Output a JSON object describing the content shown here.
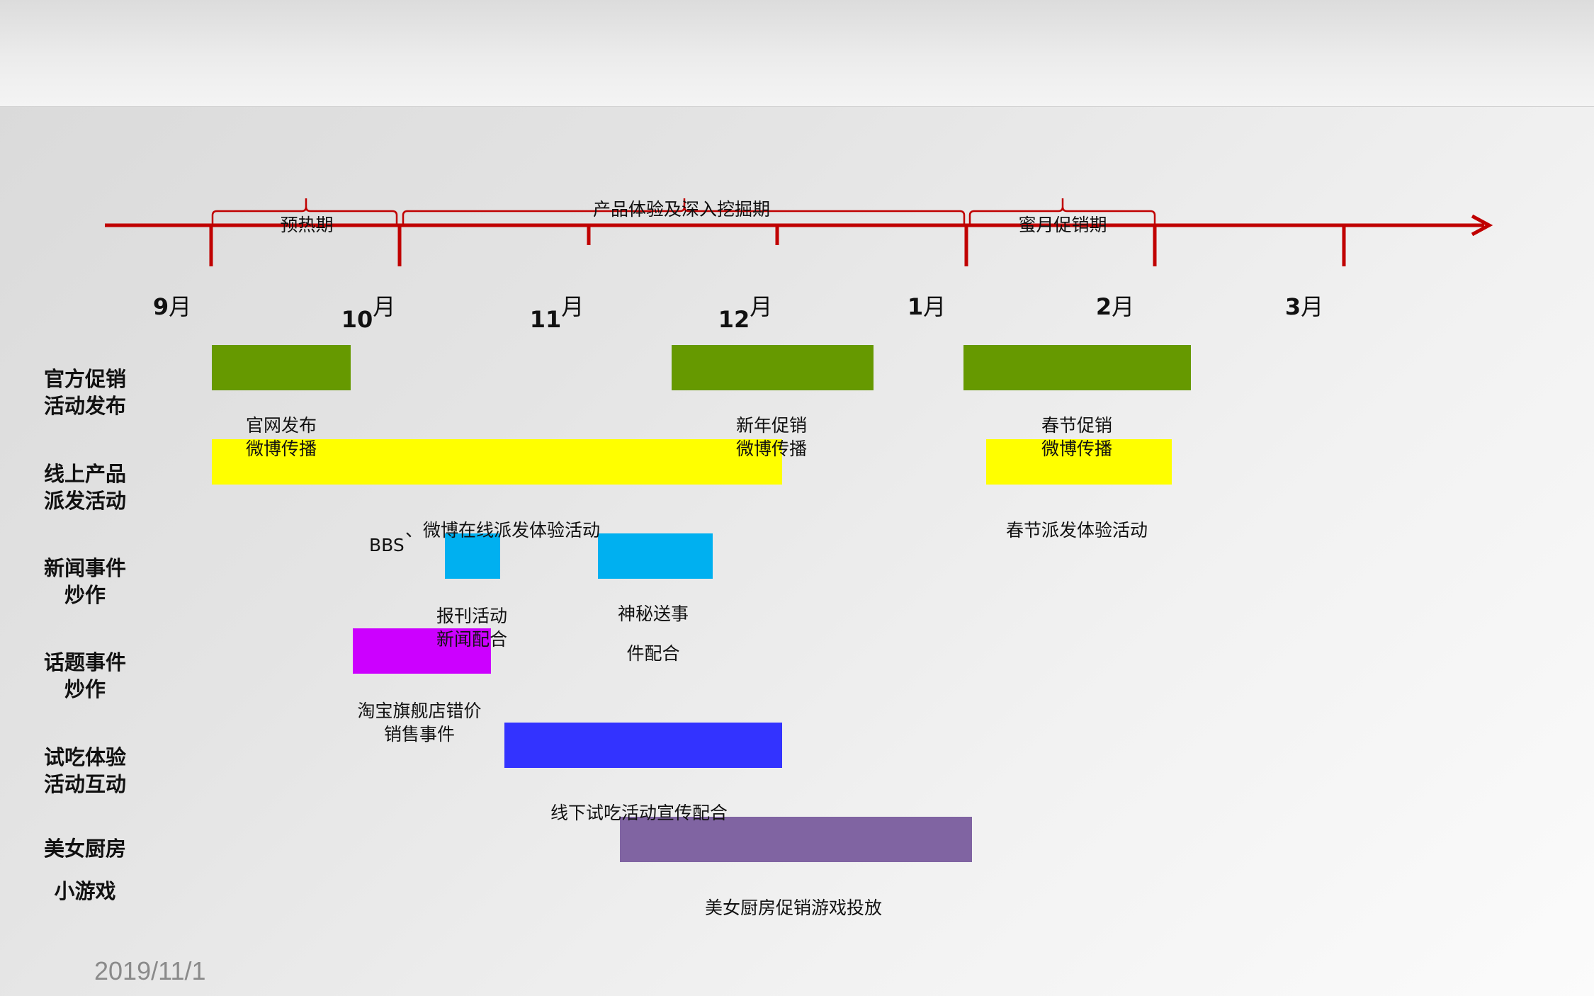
{
  "months": [
    "9月",
    "10月",
    "11月",
    "12月",
    "1月",
    "2月",
    "3月"
  ],
  "month_parts": [
    {
      "num": "9",
      "unit": "月"
    },
    {
      "num": "10",
      "unit": "月"
    },
    {
      "num": "11",
      "unit": "月"
    },
    {
      "num": "12",
      "unit": "月"
    },
    {
      "num": "1",
      "unit": "月"
    },
    {
      "num": "2",
      "unit": "月"
    },
    {
      "num": "3",
      "unit": "月"
    }
  ],
  "phases": {
    "warmup": "预热期",
    "experience": "产品体验及深入挖掘期",
    "honeymoon": "蜜月促销期"
  },
  "rows": {
    "official": "官方促销\n活动发布",
    "online": "线上产品\n派发活动",
    "news": "新闻事件\n炒作",
    "topic": "话题事件\n炒作",
    "tasting": "试吃体验\n活动互动",
    "kitchen": "美女厨房\n\n小游戏"
  },
  "captions": {
    "c1": "官网发布\n微博传播",
    "c2": "新年促销\n微博传播",
    "c3": "春节促销\n微博传播",
    "c4_bbs": "BBS",
    "c4": "、微博在线派发体验活动",
    "c5": "春节派发体验活动",
    "c6": "报刊活动\n新闻配合",
    "c7": "神秘送事\n\n件配合",
    "c8": "淘宝旗舰店错价\n销售事件",
    "c9": "线下试吃活动宣传配合",
    "c10": "美女厨房促销游戏投放"
  },
  "colors": {
    "axis": "#c00000",
    "official": "#669900",
    "online": "#ffff00",
    "news": "#00b0f0",
    "topic": "#cc00ff",
    "tasting": "#3333ff",
    "kitchen": "#8064a2"
  },
  "footer": {
    "date": "2019/11/1"
  }
}
